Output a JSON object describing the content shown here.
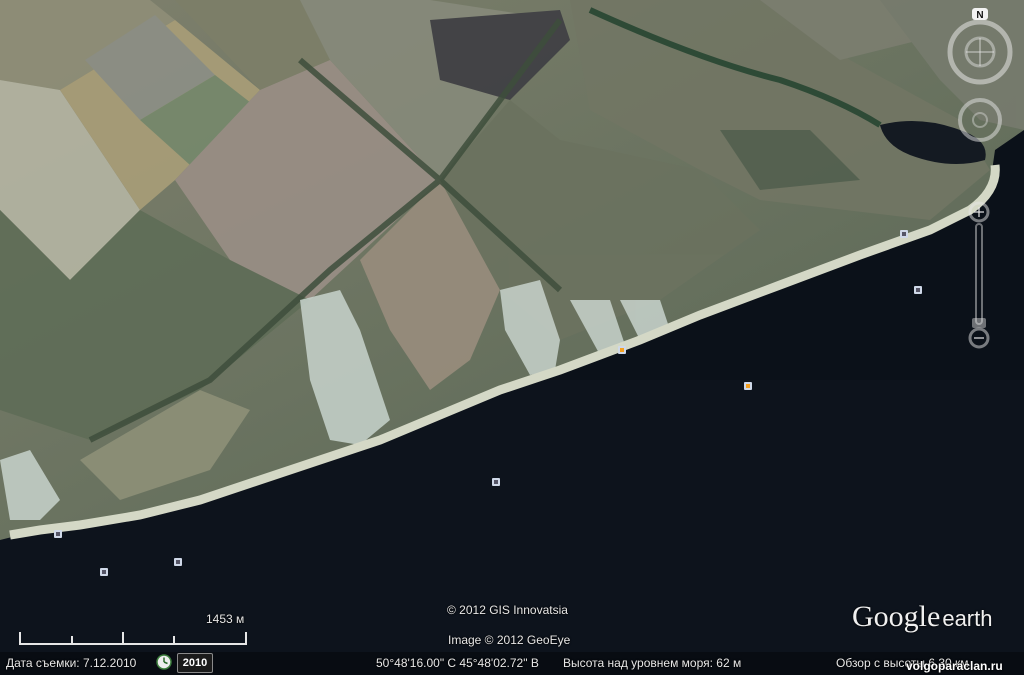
{
  "status_bar": {
    "capture_date_label": "Дата съемки: 7.12.2010",
    "year_badge": "2010",
    "coordinates": "50°48'16.00\" С  45°48'02.72\" В",
    "elevation": "Высота над уровнем моря:    62 м",
    "eye_alt": "Обзор с высоты    6.30 км"
  },
  "copyright": {
    "gis": "© 2012 GIS Innovatsia",
    "imagery": "Image © 2012 GeoEye"
  },
  "scale": {
    "label": "1453 м"
  },
  "branding": {
    "logo_text_google": "Google",
    "logo_text_earth": "earth",
    "watermark": "volgoparaclan.ru"
  },
  "compass": {
    "north_label": "N"
  },
  "colors": {
    "water": "#0b1119",
    "land": "#6d7560",
    "beach": "#d8dccb",
    "chalk": "#c9d4cc"
  }
}
